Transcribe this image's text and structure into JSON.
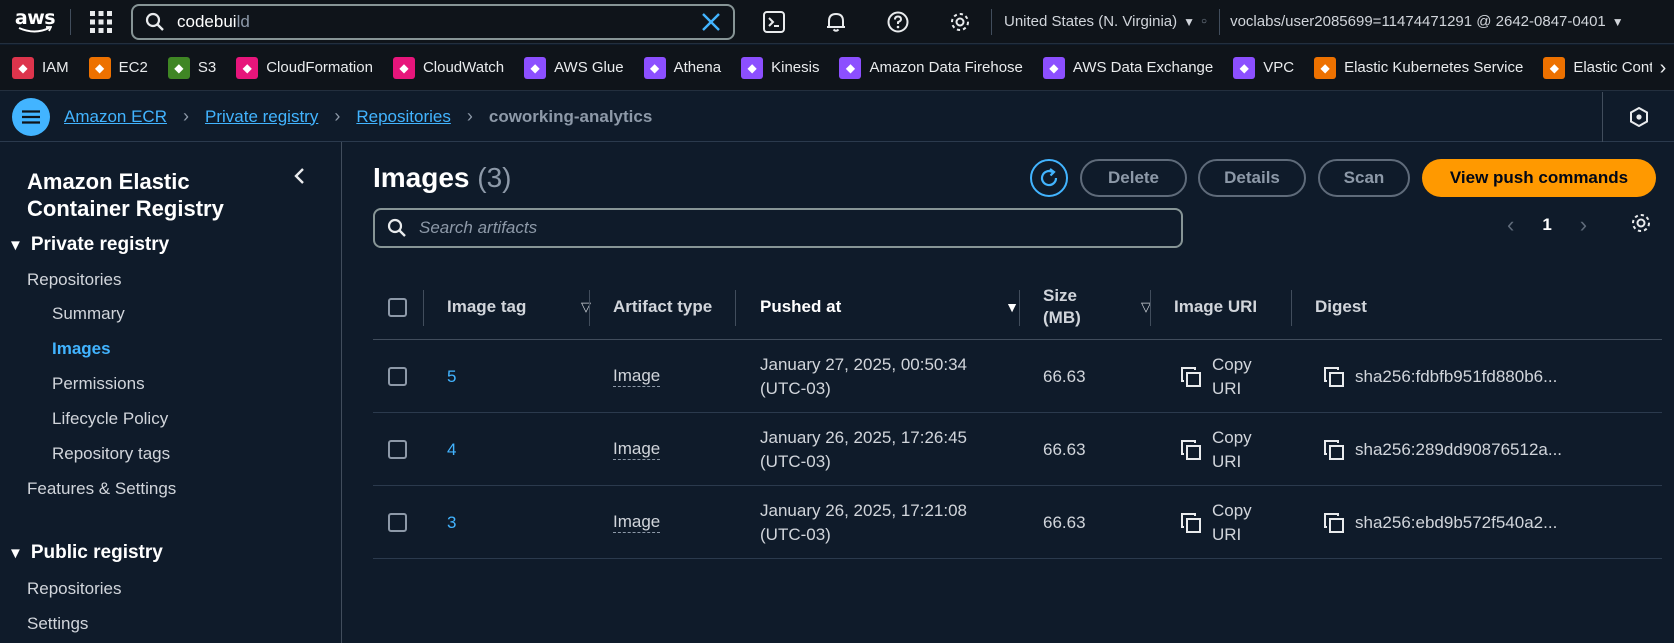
{
  "topnav": {
    "logo": "aws",
    "search_value": "codebui",
    "search_value_rest": "ld",
    "region": "United States (N. Virginia)",
    "account": "voclabs/user2085699=11474471291 @ 2642-0847-0401"
  },
  "favorites": [
    {
      "label": "IAM",
      "color": "#dd344c",
      "icon": "iam-icon"
    },
    {
      "label": "EC2",
      "color": "#ed7100",
      "icon": "ec2-icon"
    },
    {
      "label": "S3",
      "color": "#3f8624",
      "icon": "s3-icon"
    },
    {
      "label": "CloudFormation",
      "color": "#e7157b",
      "icon": "cloudformation-icon"
    },
    {
      "label": "CloudWatch",
      "color": "#e7157b",
      "icon": "cloudwatch-icon"
    },
    {
      "label": "AWS Glue",
      "color": "#8c4fff",
      "icon": "glue-icon"
    },
    {
      "label": "Athena",
      "color": "#8c4fff",
      "icon": "athena-icon"
    },
    {
      "label": "Kinesis",
      "color": "#8c4fff",
      "icon": "kinesis-icon"
    },
    {
      "label": "Amazon Data Firehose",
      "color": "#8c4fff",
      "icon": "firehose-icon"
    },
    {
      "label": "AWS Data Exchange",
      "color": "#8c4fff",
      "icon": "data-exchange-icon"
    },
    {
      "label": "VPC",
      "color": "#8c4fff",
      "icon": "vpc-icon"
    },
    {
      "label": "Elastic Kubernetes Service",
      "color": "#ed7100",
      "icon": "eks-icon"
    },
    {
      "label": "Elastic Contai",
      "color": "#ed7100",
      "icon": "ecs-icon"
    }
  ],
  "breadcrumb": {
    "items": [
      "Amazon ECR",
      "Private registry",
      "Repositories"
    ],
    "current": "coworking-analytics"
  },
  "sidebar": {
    "title": "Amazon Elastic Container Registry",
    "private_registry": "Private registry",
    "private_items": [
      "Repositories",
      "Summary",
      "Images",
      "Permissions",
      "Lifecycle Policy",
      "Repository tags",
      "Features & Settings"
    ],
    "public_registry": "Public registry",
    "public_items": [
      "Repositories",
      "Settings"
    ]
  },
  "main": {
    "title": "Images",
    "count": "(3)",
    "buttons": {
      "delete": "Delete",
      "details": "Details",
      "scan": "Scan",
      "push": "View push commands"
    },
    "search_placeholder": "Search artifacts",
    "page": "1",
    "columns": [
      "Image tag",
      "Artifact type",
      "Pushed at",
      "Size (MB)",
      "Image URI",
      "Digest"
    ],
    "rows": [
      {
        "tag": "5",
        "type": "Image",
        "pushed": "January 27, 2025, 00:50:34",
        "tz": "(UTC-03)",
        "size": "66.63",
        "uri": "Copy",
        "uri2": "URI",
        "digest": "sha256:fdbfb951fd880b6..."
      },
      {
        "tag": "4",
        "type": "Image",
        "pushed": "January 26, 2025, 17:26:45",
        "tz": "(UTC-03)",
        "size": "66.63",
        "uri": "Copy",
        "uri2": "URI",
        "digest": "sha256:289dd90876512a..."
      },
      {
        "tag": "3",
        "type": "Image",
        "pushed": "January 26, 2025, 17:21:08",
        "tz": "(UTC-03)",
        "size": "66.63",
        "uri": "Copy",
        "uri2": "URI",
        "digest": "sha256:ebd9b572f540a2..."
      }
    ]
  },
  "colors": {
    "accent": "#42b4ff",
    "primary": "#ff9900",
    "bg": "#0f1b2a"
  }
}
